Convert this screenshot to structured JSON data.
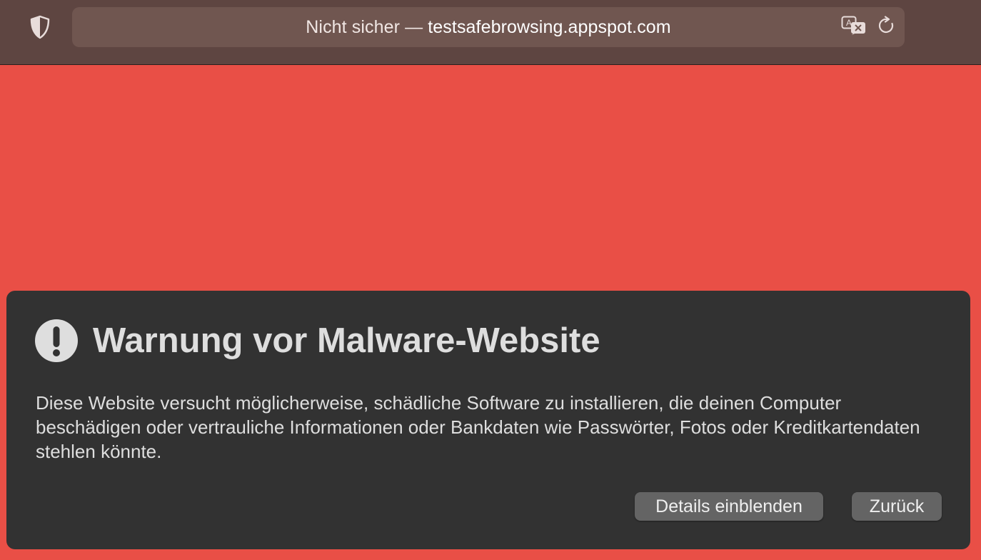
{
  "toolbar": {
    "address": {
      "prefix": "Nicht sicher — ",
      "host": "testsafebrowsing.appspot.com"
    },
    "icons": {
      "privacy": "shield-icon",
      "translate": "translate-icon",
      "reload": "reload-icon"
    }
  },
  "warning": {
    "icon": "exclamation-circle-icon",
    "title": "Warnung vor Malware-Website",
    "body": "Diese Website versucht möglicherweise, schädliche Software zu installieren, die deinen Computer beschädigen oder vertrauliche Informationen oder Bankdaten wie Passwörter, Fotos oder Kreditkartendaten stehlen könnte.",
    "details_button": "Details einblenden",
    "back_button": "Zurück"
  },
  "colors": {
    "page_background": "#e94f46",
    "toolbar_background": "#5e4541",
    "panel_background": "#323232",
    "button_background": "#646464"
  }
}
